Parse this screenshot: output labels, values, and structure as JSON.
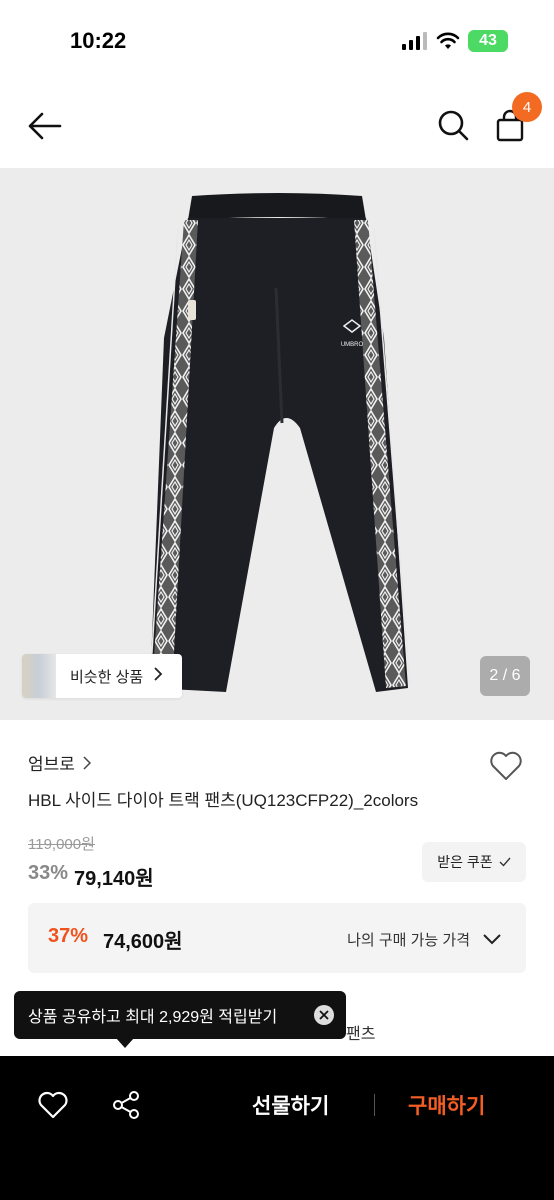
{
  "status_bar": {
    "time": "10:22",
    "battery": "43"
  },
  "header": {
    "cart_count": "4"
  },
  "gallery": {
    "similar_label": "비슷한 상품",
    "page_counter": "2 / 6",
    "logo_text": "UMBRO"
  },
  "product": {
    "brand": "엄브로",
    "name": "HBL 사이드 다이아 트랙 팬츠(UQ123CFP22)_2colors",
    "original_price": "119,000원",
    "discount_rate": "33%",
    "sale_price": "79,140원",
    "coupon_label": "받은 쿠폰"
  },
  "my_price": {
    "rate": "37%",
    "price": "74,600원",
    "label": "나의 구매 가능 가격"
  },
  "partial_text": "팬츠",
  "tooltip": {
    "text": "상품 공유하고 최대 2,929원 적립받기"
  },
  "bottom_bar": {
    "gift_label": "선물하기",
    "buy_label": "구매하기"
  },
  "colors": {
    "accent": "#f36b22",
    "buy": "#f35e25",
    "discount": "#f0521d"
  }
}
